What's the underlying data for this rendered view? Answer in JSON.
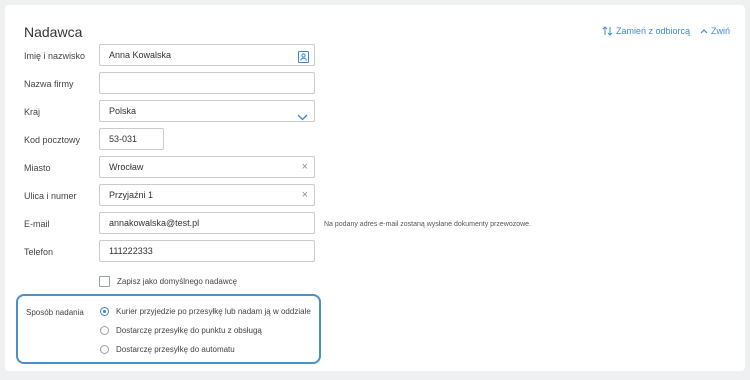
{
  "header": {
    "title": "Nadawca",
    "swap_label": "Zamień z odbiorcą",
    "collapse_label": "Zwiń"
  },
  "form": {
    "name": {
      "label": "Imię i nazwisko",
      "value": "Anna Kowalska"
    },
    "company": {
      "label": "Nazwa firmy",
      "value": ""
    },
    "country": {
      "label": "Kraj",
      "value": "Polska"
    },
    "postal": {
      "label": "Kod pocztowy",
      "value": "53-031"
    },
    "city": {
      "label": "Miasto",
      "value": "Wrocław"
    },
    "street": {
      "label": "Ulica i numer",
      "value": "Przyjaźni 1"
    },
    "email": {
      "label": "E-mail",
      "value": "annakowalska@test.pl",
      "hint": "Na podany adres e-mail zostaną wysłane dokumenty przewozowe."
    },
    "phone": {
      "label": "Telefon",
      "value": "111222333"
    },
    "default_sender": {
      "label": "Zapisz jako domyślnego nadawcę",
      "checked": false
    }
  },
  "shipping": {
    "label": "Sposób nadania",
    "options": [
      {
        "label": "Kurier przyjedzie po przesyłkę lub nadam ją w oddziale",
        "selected": true
      },
      {
        "label": "Dostarczę przesyłkę do punktu z obsługą",
        "selected": false
      },
      {
        "label": "Dostarczę przesyłkę do automatu",
        "selected": false
      }
    ]
  },
  "colors": {
    "accent": "#3a86d4",
    "highlight_border": "#4a90c8"
  },
  "icons": {
    "swap": "swap-arrows-icon",
    "collapse": "chevron-up-icon",
    "contact": "contact-card-icon",
    "dropdown": "chevron-down-icon",
    "clear": "clear-x-icon"
  }
}
